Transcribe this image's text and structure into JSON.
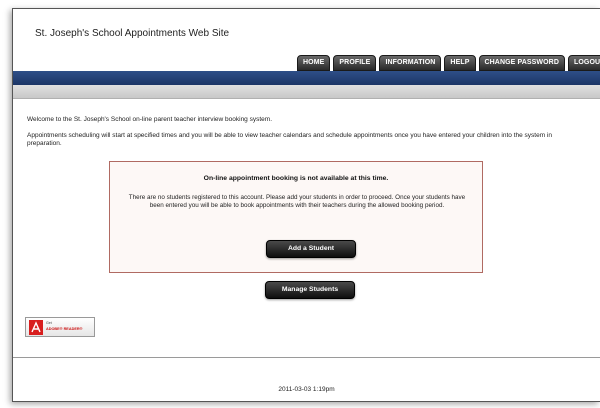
{
  "site": {
    "title": "St. Joseph's School Appointments Web Site"
  },
  "nav": {
    "tabs": [
      {
        "label": "HOME"
      },
      {
        "label": "PROFILE"
      },
      {
        "label": "INFORMATION"
      },
      {
        "label": "HELP"
      },
      {
        "label": "CHANGE PASSWORD"
      },
      {
        "label": "LOGOUT"
      }
    ]
  },
  "main": {
    "intro_line1": "Welcome to the St. Joseph's School on-line parent teacher interview booking system.",
    "intro_line2": "Appointments scheduling will start at specified times and you will be able to view teacher calendars and schedule appointments once you have entered your children into the system in preparation.",
    "notice": {
      "title": "On-line appointment booking is not available at this time.",
      "body": "There are no students registered to this account. Please add your students in order to proceed. Once your students have been entered you will be able to book appointments with their teachers during the allowed booking period.",
      "add_button": "Add a Student"
    },
    "manage_button": "Manage Students",
    "adobe_badge": {
      "get": "Get",
      "text": "ADOBE® READER®"
    }
  },
  "footer": {
    "timestamp": "2011-03-03 1:19pm"
  },
  "colors": {
    "nav_bar": "#1c3566",
    "notice_border": "#b06a62",
    "button": "#111111"
  }
}
